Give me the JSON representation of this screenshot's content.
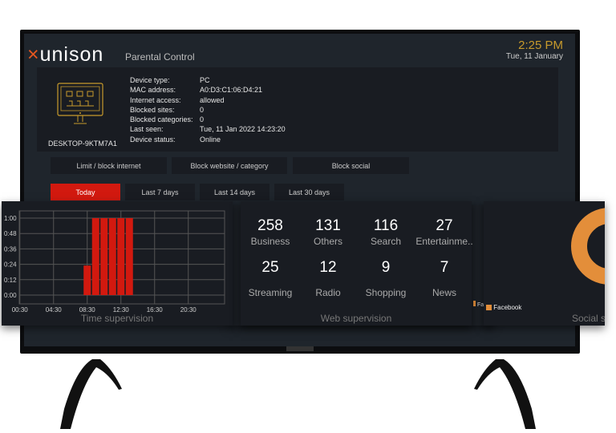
{
  "header": {
    "brand": "unison",
    "subtitle": "Parental Control",
    "time": "2:25 PM",
    "date": "Tue, 11 January"
  },
  "device": {
    "name": "DESKTOP-9KTM7A1",
    "icon": "desktop-monitor-icon",
    "fields": [
      {
        "label": "Device type:",
        "value": "PC"
      },
      {
        "label": "MAC address:",
        "value": "A0:D3:C1:06:D4:21"
      },
      {
        "label": "Internet access:",
        "value": "allowed"
      },
      {
        "label": "Blocked sites:",
        "value": "0"
      },
      {
        "label": "Blocked categories:",
        "value": "0"
      },
      {
        "label": "Last seen:",
        "value": "Tue, 11 Jan 2022 14:23:20"
      },
      {
        "label": "Device status:",
        "value": "Online"
      }
    ]
  },
  "actions": [
    "Limit / block internet",
    "Block website / category",
    "Block social"
  ],
  "ranges": {
    "items": [
      "Today",
      "Last 7 days",
      "Last 14 days",
      "Last 30 days"
    ],
    "active": "Today"
  },
  "time_card": {
    "title": "Time supervision"
  },
  "web_card": {
    "title": "Web supervision",
    "items": [
      {
        "count": "258",
        "label": "Business"
      },
      {
        "count": "131",
        "label": "Others"
      },
      {
        "count": "116",
        "label": "Search"
      },
      {
        "count": "27",
        "label": "Entertainme.."
      },
      {
        "count": "25",
        "label": "Streaming"
      },
      {
        "count": "12",
        "label": "Radio"
      },
      {
        "count": "9",
        "label": "Shopping"
      },
      {
        "count": "7",
        "label": "News"
      }
    ]
  },
  "social_card": {
    "title": "Social s",
    "legend": "Facebook",
    "behind_legend": "Fa"
  },
  "colors": {
    "accent": "#d2190f",
    "gold": "#c79a2c",
    "facebook": "#e38e3a",
    "logo_dot": "#e5571f"
  },
  "chart_data": {
    "type": "bar",
    "title": "Time supervision",
    "x_ticks": [
      "00:30",
      "04:30",
      "08:30",
      "12:30",
      "16:30",
      "20:30"
    ],
    "y_ticks": [
      "0:00",
      "0:12",
      "0:24",
      "0:36",
      "0:48",
      "1:00"
    ],
    "ylim_minutes": [
      0,
      60
    ],
    "grid": true,
    "categories": [
      "08:30",
      "09:30",
      "10:30",
      "11:30",
      "12:30",
      "13:30"
    ],
    "values_minutes": [
      23,
      60,
      60,
      60,
      60,
      60
    ],
    "color": "#d2190f"
  }
}
